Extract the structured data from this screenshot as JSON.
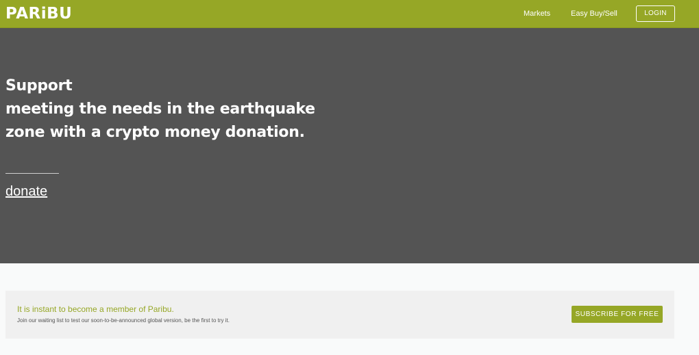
{
  "header": {
    "logo_text": "PARiBU",
    "nav": {
      "markets": "Markets",
      "easy_buy_sell": "Easy Buy/Sell",
      "login": "LOGIN"
    }
  },
  "hero": {
    "heading_lines": [
      "Support",
      "meeting the needs in the earthquake",
      "zone with a crypto money donation."
    ],
    "donate_link": "donate"
  },
  "cta": {
    "title": "It is instant to become a member of Paribu.",
    "subtitle": "Join our waiting list to test our soon-to-be-announced global version, be the first to try it.",
    "button": "SUBSCRIBE FOR FREE"
  },
  "colors": {
    "brand": "#96a726",
    "hero_bg": "#545454",
    "page_bg": "#f9fafa"
  }
}
